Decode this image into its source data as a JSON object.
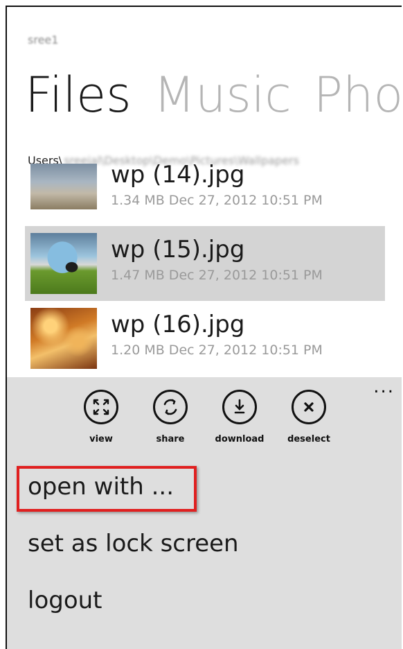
{
  "header": {
    "account": "sree1",
    "pivot_tabs": [
      "Files",
      "Music",
      "Photos"
    ],
    "path_prefix": "Users\\",
    "path_blurred": "sreejal\\Desktop\\Demo\\Pictures\\Wallpapers"
  },
  "files": [
    {
      "name": "wp (14).jpg",
      "meta": "1.34 MB Dec 27, 2012 10:51 PM"
    },
    {
      "name": "wp (15).jpg",
      "meta": "1.47 MB Dec 27, 2012 10:51 PM"
    },
    {
      "name": "wp (16).jpg",
      "meta": "1.20 MB Dec 27, 2012 10:51 PM"
    }
  ],
  "appbar": {
    "ellipsis": "...",
    "buttons": [
      {
        "label": "view",
        "icon": "expand-icon"
      },
      {
        "label": "share",
        "icon": "share-icon"
      },
      {
        "label": "download",
        "icon": "download-icon"
      },
      {
        "label": "deselect",
        "icon": "close-icon"
      }
    ],
    "menu": [
      "open with ...",
      "set as lock screen",
      "logout"
    ]
  },
  "colors": {
    "appbar_bg": "#dedede",
    "selected_row": "#d4d4d4",
    "highlight_box": "#e02020"
  }
}
